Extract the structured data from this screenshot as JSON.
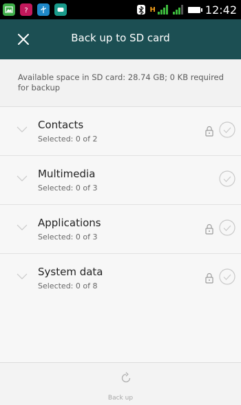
{
  "status_bar": {
    "time": "12:42",
    "network_type": "H",
    "notification_icons": [
      "gallery-app-icon",
      "help-app-icon",
      "usb-icon",
      "chat-app-icon"
    ],
    "colors": {
      "background": "#000000",
      "signal": "#3dbb3d",
      "network": "#f7a01a"
    }
  },
  "header": {
    "title": "Back up to SD card",
    "close_icon": "close-icon",
    "background_color": "#1c4f53"
  },
  "info": {
    "text": "Available space in SD card: 28.74 GB; 0 KB required for backup"
  },
  "categories": [
    {
      "title": "Contacts",
      "subtitle": "Selected: 0 of 2",
      "locked": true
    },
    {
      "title": "Multimedia",
      "subtitle": "Selected: 0 of 3",
      "locked": false
    },
    {
      "title": "Applications",
      "subtitle": "Selected: 0 of 3",
      "locked": true
    },
    {
      "title": "System data",
      "subtitle": "Selected: 0 of 8",
      "locked": true
    }
  ],
  "bottom_bar": {
    "label": "Back up",
    "icon": "refresh-icon",
    "enabled": false
  }
}
